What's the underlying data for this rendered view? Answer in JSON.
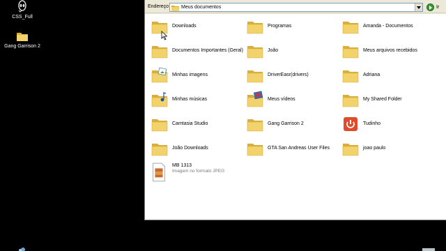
{
  "desktop": {
    "icons": [
      {
        "label": "CSS_Full",
        "icon": "alienware-shortcut-icon"
      },
      {
        "label": "Gang Garrison 2",
        "icon": "folder-icon"
      }
    ]
  },
  "explorer": {
    "address_label": "Endereço",
    "address_value": "Meus documentos",
    "go_label": "Ir",
    "items": [
      {
        "name": "Downloads",
        "icon": "folder-icon"
      },
      {
        "name": "Programas",
        "icon": "folder-icon"
      },
      {
        "name": "Amanda - Documentos",
        "icon": "folder-icon"
      },
      {
        "name": "Documentos Importantes (Geral)",
        "icon": "folder-icon"
      },
      {
        "name": "João",
        "icon": "folder-icon"
      },
      {
        "name": "Meus arquivos recebidos",
        "icon": "folder-icon"
      },
      {
        "name": "Minhas imagens",
        "icon": "pictures-folder-icon"
      },
      {
        "name": "DriverEasr(drivers)",
        "icon": "folder-icon"
      },
      {
        "name": "Adriana",
        "icon": "folder-icon"
      },
      {
        "name": "Minhas músicas",
        "icon": "music-folder-icon"
      },
      {
        "name": "Meus vídeos",
        "icon": "videos-folder-icon"
      },
      {
        "name": "My Shared Folder",
        "icon": "folder-icon"
      },
      {
        "name": "Camtasia Studio",
        "icon": "folder-icon"
      },
      {
        "name": "Gang Garrison 2",
        "icon": "folder-icon"
      },
      {
        "name": "Tudinho",
        "icon": "power-app-icon"
      },
      {
        "name": "João Downloads",
        "icon": "folder-icon"
      },
      {
        "name": "GTA San Andreas User Files",
        "icon": "folder-icon"
      },
      {
        "name": "joao paulo",
        "icon": "folder-icon"
      },
      {
        "name": "MB 1313",
        "type": "Imagem no formato JPEG",
        "icon": "jpeg-file-icon"
      }
    ]
  },
  "colors": {
    "folder": "#f2d26a",
    "folder_dark": "#d9ae3c",
    "window_bg": "#ece9d8",
    "desktop_bg": "#000000",
    "tudinho_red": "#e24a2c"
  }
}
